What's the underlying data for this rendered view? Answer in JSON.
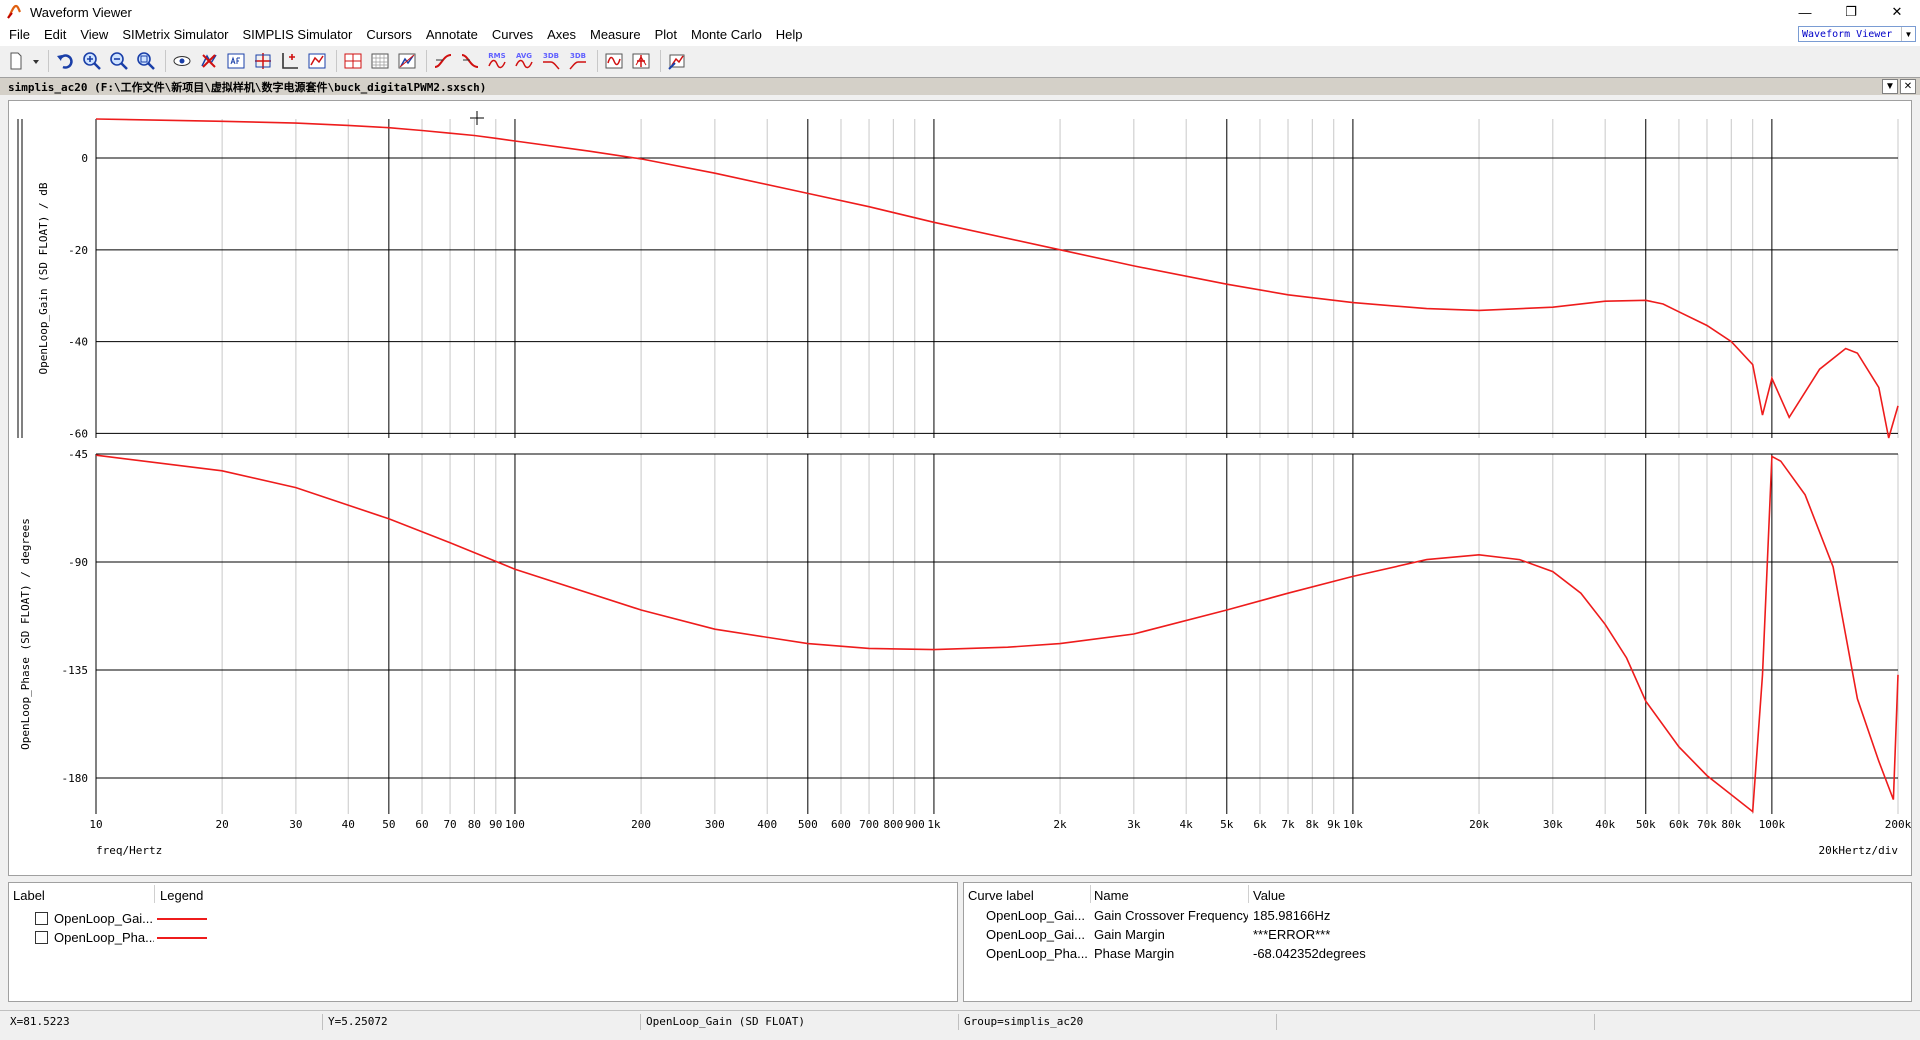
{
  "window": {
    "title": "Waveform Viewer",
    "controls": [
      "—",
      "❐",
      "✕"
    ]
  },
  "menu": [
    "File",
    "Edit",
    "View",
    "SIMetrix Simulator",
    "SIMPLIS Simulator",
    "Cursors",
    "Annotate",
    "Curves",
    "Axes",
    "Measure",
    "Plot",
    "Monte Carlo",
    "Help"
  ],
  "view_select": "Waveform Viewer",
  "toolbar": {
    "icons": [
      "new-icon",
      "dropdown-arrow-icon",
      "undo-icon",
      "zoom-in-icon",
      "zoom-out-icon",
      "zoom-fit-icon",
      "view-icon",
      "delete-curve-icon",
      "text-icon",
      "cursor-icon",
      "new-axis-icon",
      "new-grid-icon",
      "measure-icon",
      "rise-icon",
      "fall-icon",
      "rms-icon",
      "avg-icon",
      "3db-low-icon",
      "3db-high-icon",
      "fft-icon",
      "histogram-icon",
      "wizard-icon"
    ],
    "text_buttons": [
      "RMS",
      "AVG",
      "3DB",
      "3DB"
    ]
  },
  "graph_strip": {
    "title": "simplis_ac20 (F:\\工作文件\\新项目\\虚拟样机\\数字电源套件\\buck_digitalPWM2.sxsch)"
  },
  "colors": {
    "curve": "#ee1c1c",
    "grid_major": "#000000",
    "grid_minor": "#c8c8c8"
  },
  "chart_data": [
    {
      "type": "line",
      "title": "",
      "ylabel": "OpenLoop_Gain (SD FLOAT) / dB",
      "xlabel": "freq/Hertz",
      "xscale": "log",
      "xlim": [
        10,
        200000
      ],
      "ylim": [
        -61,
        8.5
      ],
      "yticks": [
        0,
        -20,
        -40,
        -60
      ],
      "grid": true,
      "series": [
        {
          "name": "OpenLoop_Gain",
          "x": [
            10,
            20,
            30,
            40,
            50,
            60,
            70,
            80,
            90,
            100,
            150,
            200,
            300,
            500,
            700,
            1000,
            2000,
            3000,
            5000,
            7000,
            10000,
            15000,
            20000,
            30000,
            40000,
            50000,
            55000,
            60000,
            70000,
            80000,
            90000,
            95000,
            100000,
            110000,
            130000,
            150000,
            160000,
            180000,
            190000,
            200000
          ],
          "y": [
            8.5,
            8,
            7.6,
            7.1,
            6.6,
            6.0,
            5.4,
            4.9,
            4.3,
            3.7,
            1.5,
            -0.2,
            -3.3,
            -7.7,
            -10.6,
            -14.0,
            -20.0,
            -23.5,
            -27.5,
            -29.8,
            -31.5,
            -32.8,
            -33.2,
            -32.5,
            -31.2,
            -31.0,
            -31.8,
            -33.5,
            -36.5,
            -40.0,
            -45.0,
            -56.0,
            -48.0,
            -56.5,
            -46.0,
            -41.5,
            -42.5,
            -50.0,
            -61.0,
            -54.0
          ]
        }
      ]
    },
    {
      "type": "line",
      "title": "",
      "ylabel": "OpenLoop_Phase (SD FLOAT) / degrees",
      "xlabel": "freq/Hertz",
      "xscale": "log",
      "xlim": [
        10,
        200000
      ],
      "ylim": [
        -195,
        -45
      ],
      "ytick_labels": [
        "-45",
        "-90",
        "-135",
        "-180"
      ],
      "ytick_values": [
        -45,
        -90,
        -135,
        -180
      ],
      "x_tick_values": [
        10,
        20,
        30,
        40,
        50,
        60,
        70,
        80,
        90,
        100,
        200,
        300,
        400,
        500,
        600,
        700,
        800,
        900,
        1000,
        2000,
        3000,
        4000,
        5000,
        6000,
        7000,
        8000,
        9000,
        10000,
        20000,
        30000,
        40000,
        50000,
        60000,
        70000,
        80000,
        100000,
        200000
      ],
      "x_tick_labels": [
        "10",
        "20",
        "30",
        "40",
        "50",
        "60",
        "70",
        "80",
        "90",
        "100",
        "200",
        "300",
        "400",
        "500",
        "600",
        "700",
        "800",
        "900",
        "1k",
        "2k",
        "3k",
        "4k",
        "5k",
        "6k",
        "7k",
        "8k",
        "9k",
        "10k",
        "20k",
        "30k",
        "40k",
        "50k",
        "60k",
        "70k",
        "80k",
        "100k",
        "200k"
      ],
      "x_right_label": "20kHertz/div",
      "grid": true,
      "series": [
        {
          "name": "OpenLoop_Phase",
          "x": [
            10,
            20,
            30,
            50,
            70,
            100,
            200,
            300,
            500,
            700,
            1000,
            1500,
            2000,
            3000,
            5000,
            7000,
            10000,
            15000,
            20000,
            25000,
            30000,
            35000,
            40000,
            45000,
            50000,
            60000,
            70000,
            80000,
            90000,
            95000,
            100000,
            105000,
            120000,
            140000,
            160000,
            180000,
            195000,
            200000
          ],
          "y": [
            -45.5,
            -52,
            -59,
            -72,
            -82,
            -93,
            -110,
            -118,
            -124,
            -126,
            -126.5,
            -125.5,
            -124,
            -120,
            -110,
            -103,
            -96,
            -89,
            -87,
            -89,
            -94,
            -103,
            -116,
            -130,
            -148,
            -167,
            -179,
            -187,
            -194,
            -137,
            -46,
            -48,
            -62,
            -92,
            -147,
            -173,
            -189,
            -137
          ]
        }
      ]
    }
  ],
  "legend_panel": {
    "headers": [
      "Label",
      "Legend"
    ],
    "rows": [
      {
        "label": "OpenLoop_Gai...",
        "checked": false
      },
      {
        "label": "OpenLoop_Pha...",
        "checked": false
      }
    ]
  },
  "measure_panel": {
    "headers": [
      "Curve label",
      "Name",
      "Value"
    ],
    "rows": [
      {
        "curve": "OpenLoop_Gai...",
        "name": "Gain Crossover Frequency",
        "value": "185.98166Hz"
      },
      {
        "curve": "OpenLoop_Gai...",
        "name": "Gain Margin",
        "value": "***ERROR***"
      },
      {
        "curve": "OpenLoop_Pha...",
        "name": "Phase Margin",
        "value": "-68.042352degrees"
      }
    ]
  },
  "status": {
    "x": "X=81.5223",
    "y": "Y=5.25072",
    "curve": "OpenLoop_Gain (SD FLOAT)",
    "group": "Group=simplis_ac20"
  }
}
